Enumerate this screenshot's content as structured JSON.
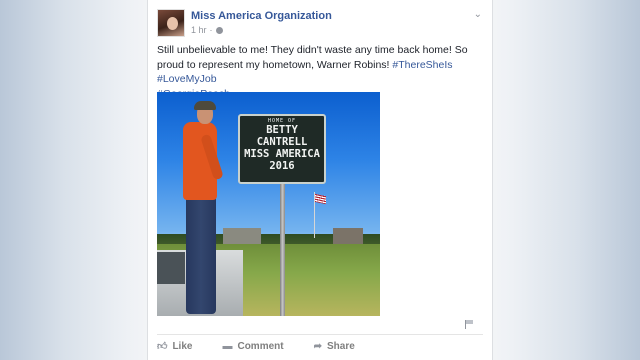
{
  "post": {
    "page_name": "Miss America Organization",
    "time": "1 hr",
    "text_before": "Still unbelievable to me! They didn't waste any time back home! So proud to represent my hometown, Warner Robins! ",
    "hashtags": [
      "#ThereSheIs",
      "#LoveMyJob",
      "#GeorgiaPeach"
    ],
    "icons": {
      "privacy": "globe-icon",
      "menu": "chevron-down-icon",
      "report": "flag-icon"
    }
  },
  "photo_sign": {
    "line1": "HOME OF",
    "line2": "BETTY",
    "line3": "CANTRELL",
    "line4": "MISS AMERICA",
    "line5": "2016"
  },
  "actions": {
    "like": "Like",
    "comment": "Comment",
    "share": "Share",
    "like_icon": "thumbs-up-icon",
    "comment_icon": "comment-icon",
    "share_icon": "share-arrow-icon"
  },
  "colors": {
    "link": "#365899",
    "text": "#1d2129",
    "meta": "#90949c"
  }
}
